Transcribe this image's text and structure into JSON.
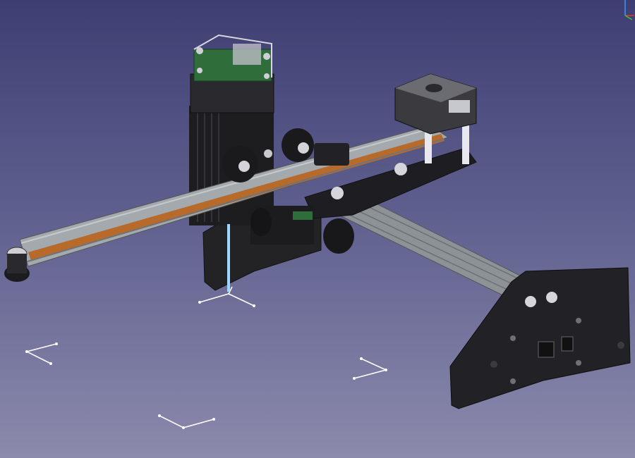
{
  "viewport": {
    "background_top": "#3e3e72",
    "background_bottom": "#8b8aac"
  },
  "model": {
    "frame_color": "#1f1f22",
    "rail_color": "#9ea3a8",
    "belt_color": "#b86a2a",
    "pcb_color": "#2f6d3a",
    "laser_beam_color": "#9fd8ff"
  },
  "axis_indicator": {
    "x_color": "#e33",
    "y_color": "#3c3",
    "z_color": "#39f"
  },
  "icons": [
    "axis-cross-icon",
    "corner-bracket-icon"
  ]
}
